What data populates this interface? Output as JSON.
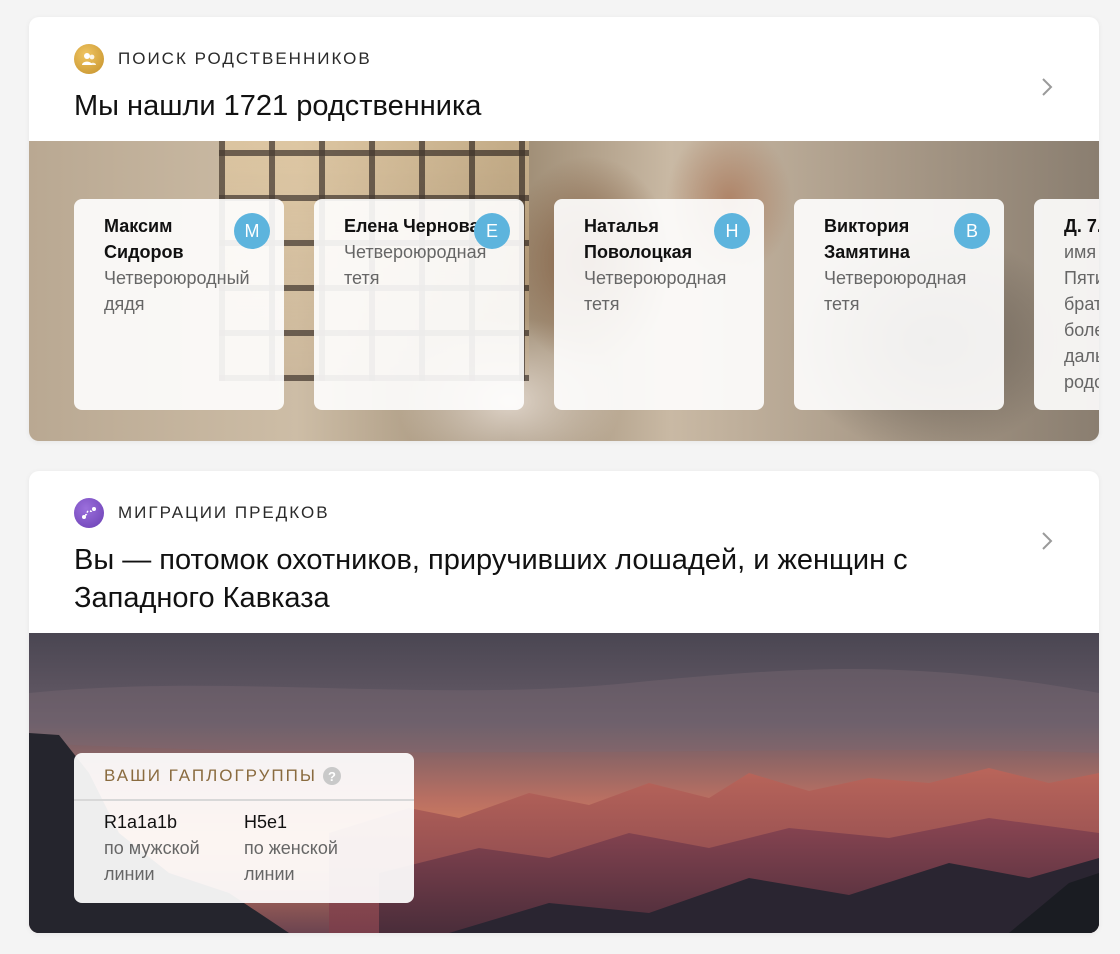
{
  "relatives": {
    "section_label": "Поиск родственников",
    "title": "Мы нашли 1721 родственника",
    "icon_color": "#d4a23a",
    "cards": [
      {
        "name": "Максим Сидоров",
        "initial": "М",
        "relation": "Четвероюродный дядя"
      },
      {
        "name": "Елена Чернова",
        "initial": "Е",
        "relation": "Четвероюродная тетя"
      },
      {
        "name": "Наталья Поволоцкая",
        "initial": "Н",
        "relation": "Четвероюродная тетя"
      },
      {
        "name": "Виктория Замятина",
        "initial": "В",
        "relation": "Четвероюродная тетя"
      }
    ],
    "partial_card": {
      "name": "Д. 7.",
      "lines": [
        "имя",
        "Пяти",
        "брат",
        "боле",
        "даль",
        "родс"
      ]
    }
  },
  "migrations": {
    "section_label": "Миграции предков",
    "title": "Вы — потомок охотников, приручивших лошадей, и женщин с Западного Кавказа",
    "icon_color": "#7b4fc0",
    "haplogroups": {
      "title": "Ваши гаплогруппы",
      "help": "?",
      "male": {
        "code": "R1a1a1b",
        "desc": "по мужской линии"
      },
      "female": {
        "code": "H5e1",
        "desc": "по женской линии"
      }
    }
  },
  "colors": {
    "avatar": "#5db4dd",
    "haplo_title": "#8a6b3f"
  }
}
